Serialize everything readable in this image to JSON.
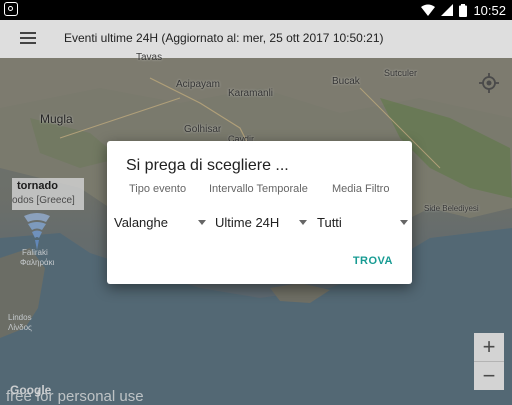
{
  "status_bar": {
    "time": "10:52"
  },
  "toolbar": {
    "title": "Eventi ultime 24H (Aggiornato al: mer, 25 ott 2017 10:50:21)"
  },
  "map": {
    "places": [
      "Tavas",
      "Acipayam",
      "Karamanli",
      "Bucak",
      "Mugla",
      "Golhisar",
      "Side Belediyesi",
      "Faliraki",
      "Φαληράκι",
      "Lindos",
      "Λίνδος",
      "Cavdir",
      "Sutculer"
    ],
    "marker_card": {
      "title": "tornado",
      "subtitle": "odos [Greece]"
    },
    "zoom_in": "+",
    "zoom_out": "−",
    "google_logo": "Google",
    "watermark": "free for personal use"
  },
  "dialog": {
    "title": "Si prega di scegliere ...",
    "columns": [
      {
        "label": "Tipo evento",
        "value": "Valanghe"
      },
      {
        "label": "Intervallo Temporale",
        "value": "Ultime 24H"
      },
      {
        "label": "Media Filtro",
        "value": "Tutti"
      }
    ],
    "action_label": "TROVA"
  },
  "colors": {
    "toolbar_bg": "#dedede",
    "accent": "#179b93",
    "status_bar_bg": "#000000"
  }
}
